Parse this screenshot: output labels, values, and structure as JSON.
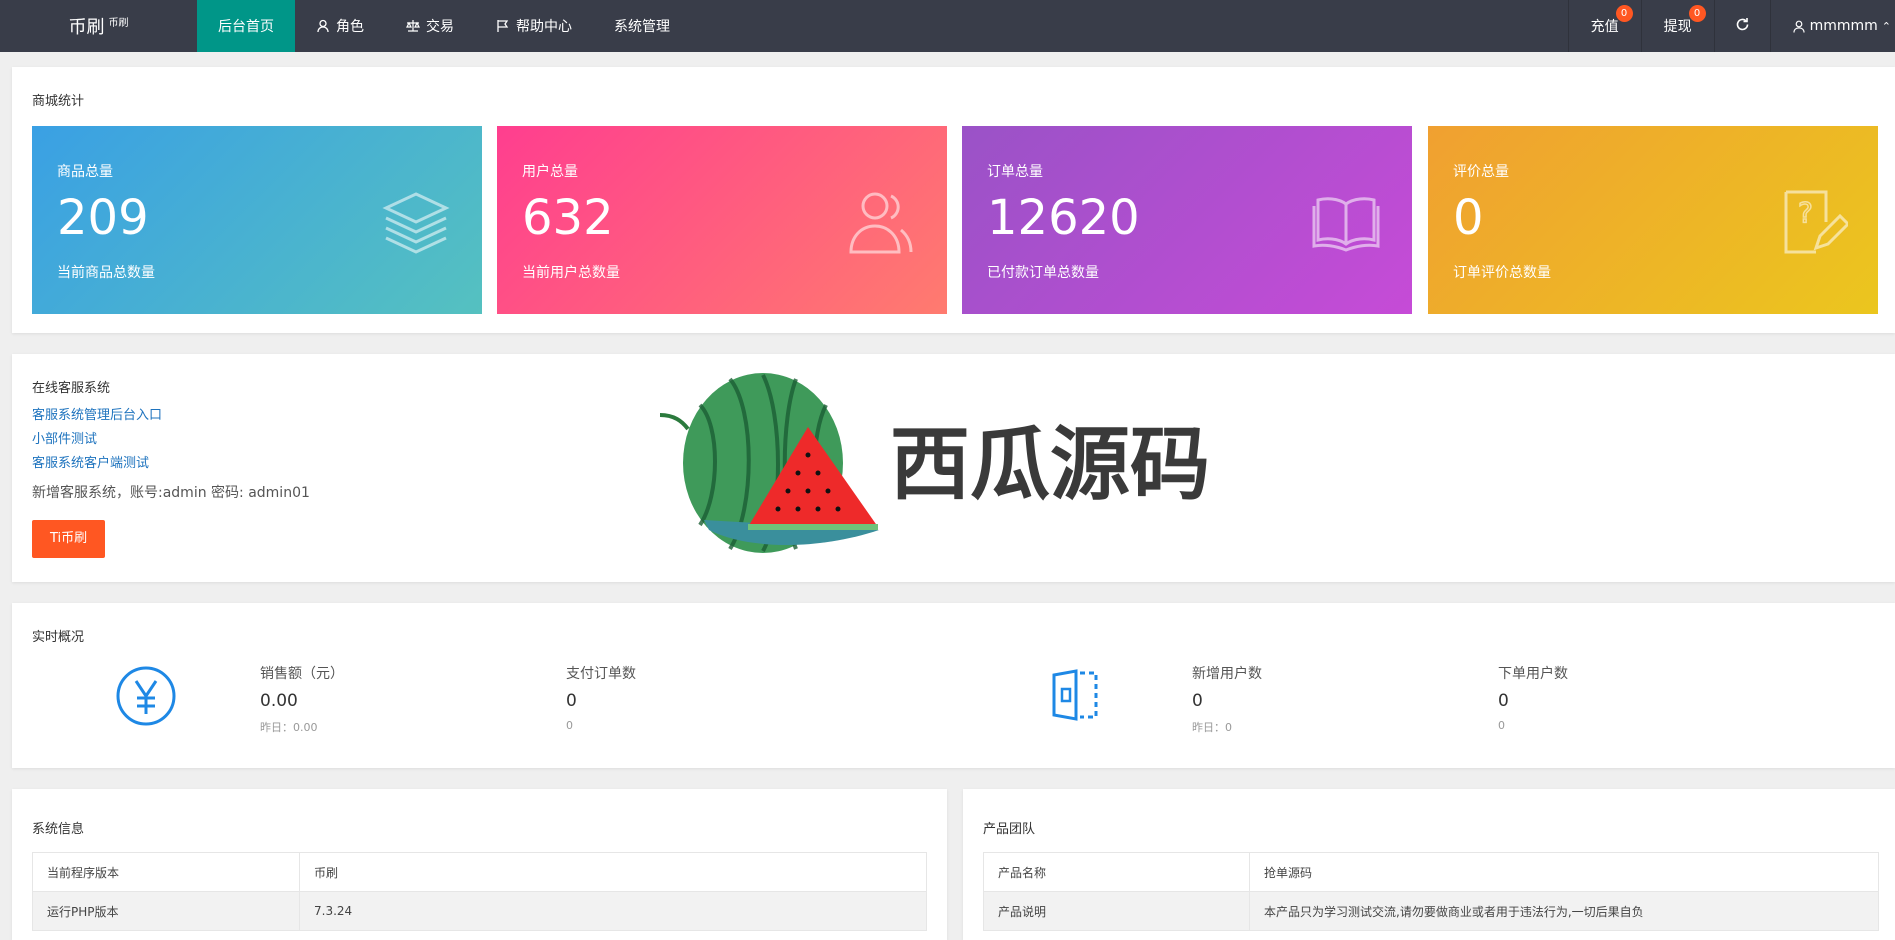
{
  "brand": {
    "name": "币刷",
    "sub": "币刷"
  },
  "nav": [
    {
      "label": "后台首页",
      "icon": "",
      "active": true
    },
    {
      "label": "角色",
      "icon": "user-icon"
    },
    {
      "label": "交易",
      "icon": "scale-icon"
    },
    {
      "label": "帮助中心",
      "icon": "flag-icon"
    },
    {
      "label": "系统管理",
      "icon": ""
    }
  ],
  "topright": {
    "recharge": {
      "label": "充值",
      "badge": "0"
    },
    "withdraw": {
      "label": "提现",
      "badge": "0"
    },
    "refresh_icon": "refresh-icon",
    "user": {
      "label": "mmmmm",
      "icon": "user-icon"
    }
  },
  "mall": {
    "title": "商城统计",
    "cards": [
      {
        "label": "商品总量",
        "value": "209",
        "sub": "当前商品总数量",
        "icon": "layers-icon"
      },
      {
        "label": "用户总量",
        "value": "632",
        "sub": "当前用户总数量",
        "icon": "users-icon"
      },
      {
        "label": "订单总量",
        "value": "12620",
        "sub": "已付款订单总数量",
        "icon": "book-icon"
      },
      {
        "label": "评价总量",
        "value": "0",
        "sub": "订单评价总数量",
        "icon": "question-edit-icon"
      }
    ]
  },
  "cs": {
    "title": "在线客服系统",
    "links": [
      "客服系统管理后台入口",
      "小部件测试",
      "客服系统客户端测试"
    ],
    "note": "新增客服系统，账号:admin 密码: admin01",
    "button": "Ti币刷"
  },
  "watermark": {
    "text": "西瓜源码"
  },
  "realtime": {
    "title": "实时概况",
    "items": [
      {
        "label": "销售额（元）",
        "value": "0.00",
        "yesterday": "昨日：0.00"
      },
      {
        "label": "支付订单数",
        "value": "0",
        "yesterday": "0"
      },
      {
        "label": "新增用户数",
        "value": "0",
        "yesterday": "昨日：0"
      },
      {
        "label": "下单用户数",
        "value": "0",
        "yesterday": "0"
      }
    ]
  },
  "sysinfo": {
    "title": "系统信息",
    "rows": [
      [
        "当前程序版本",
        "币刷"
      ],
      [
        "运行PHP版本",
        "7.3.24"
      ]
    ]
  },
  "team": {
    "title": "产品团队",
    "rows": [
      [
        "产品名称",
        "抢单源码"
      ],
      [
        "产品说明",
        "本产品只为学习测试交流,请勿要做商业或者用于违法行为,一切后果自负"
      ]
    ]
  },
  "colors": {
    "topbar": "#393d49",
    "active": "#009688",
    "badge": "#ff5722",
    "card1": [
      "#3aa0e4",
      "#55c1c0"
    ],
    "card2": [
      "#ff3e8f",
      "#ff7b6f"
    ],
    "card3": [
      "#9a52c7",
      "#c64bd7"
    ],
    "card4": [
      "#f0a031",
      "#ebc61e"
    ]
  }
}
